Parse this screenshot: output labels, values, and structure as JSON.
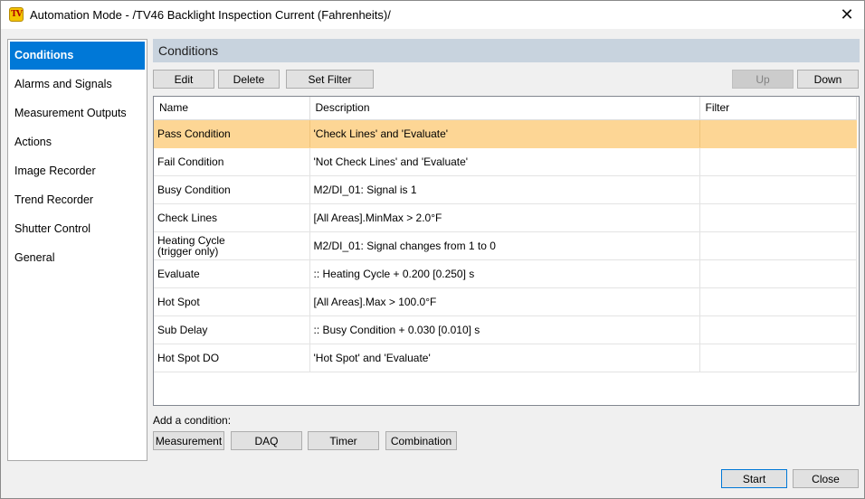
{
  "window": {
    "app_icon_text": "TV",
    "title": "Automation Mode - /TV46 Backlight Inspection Current (Fahrenheits)/",
    "close_glyph": "✕"
  },
  "sidebar": {
    "items": [
      {
        "label": "Conditions"
      },
      {
        "label": "Alarms and Signals"
      },
      {
        "label": "Measurement Outputs"
      },
      {
        "label": "Actions"
      },
      {
        "label": "Image Recorder"
      },
      {
        "label": "Trend Recorder"
      },
      {
        "label": "Shutter Control"
      },
      {
        "label": "General"
      }
    ],
    "selected": "Conditions"
  },
  "main": {
    "header": "Conditions",
    "toolbar": {
      "edit": "Edit",
      "delete": "Delete",
      "set_filter": "Set Filter",
      "up": "Up",
      "down": "Down"
    },
    "table": {
      "columns": [
        "Name",
        "Description",
        "Filter"
      ],
      "rows": [
        {
          "name": "Pass Condition",
          "description": "'Check Lines' and 'Evaluate'",
          "filter": ""
        },
        {
          "name": "Fail Condition",
          "description": "'Not Check Lines' and 'Evaluate'",
          "filter": ""
        },
        {
          "name": "Busy Condition",
          "description": "M2/DI_01: Signal is 1",
          "filter": ""
        },
        {
          "name": "Check Lines",
          "description": "[All Areas].MinMax > 2.0°F",
          "filter": ""
        },
        {
          "name": "Heating Cycle\n(trigger only)",
          "description": "M2/DI_01: Signal changes from 1 to 0",
          "filter": ""
        },
        {
          "name": "Evaluate",
          "description": ":: Heating Cycle + 0.200 [0.250] s",
          "filter": ""
        },
        {
          "name": "Hot Spot",
          "description": "[All Areas].Max > 100.0°F",
          "filter": ""
        },
        {
          "name": "Sub Delay",
          "description": ":: Busy Condition + 0.030 [0.010] s",
          "filter": ""
        },
        {
          "name": "Hot Spot DO",
          "description": "'Hot Spot' and 'Evaluate'",
          "filter": ""
        }
      ],
      "selected_row": "Pass Condition",
      "selected_color": "#fdd695"
    },
    "add_condition": {
      "label": "Add a condition:",
      "buttons": {
        "measurement": "Measurement",
        "daq": "DAQ",
        "timer": "Timer",
        "combination": "Combination"
      }
    }
  },
  "footer": {
    "start": "Start",
    "close": "Close"
  },
  "colors": {
    "accent": "#0078d7",
    "header_bg": "#c8d3de"
  }
}
